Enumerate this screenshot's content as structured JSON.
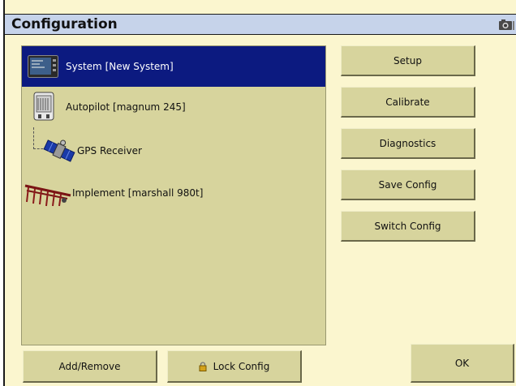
{
  "window": {
    "title": "Configuration"
  },
  "titlebar": {
    "screenshot_icon": "camera-icon"
  },
  "tree": {
    "items": [
      {
        "label": "System [New System]",
        "icon": "display-icon",
        "selected": true
      },
      {
        "label": "Autopilot [magnum 245]",
        "icon": "autopilot-controller-icon",
        "selected": false
      },
      {
        "label": "GPS Receiver",
        "icon": "satellite-icon",
        "selected": false
      },
      {
        "label": "Implement [marshall 980t]",
        "icon": "implement-icon",
        "selected": false
      }
    ]
  },
  "actions": {
    "setup": "Setup",
    "calibrate": "Calibrate",
    "diagnostics": "Diagnostics",
    "save_config": "Save Config",
    "switch_config": "Switch Config"
  },
  "footer": {
    "add_remove": "Add/Remove",
    "lock_config": "Lock Config",
    "ok": "OK"
  },
  "colors": {
    "background": "#fbf6cf",
    "panel": "#d7d49d",
    "title_bar": "#c6d3ea",
    "selection": "#0c1a80"
  }
}
